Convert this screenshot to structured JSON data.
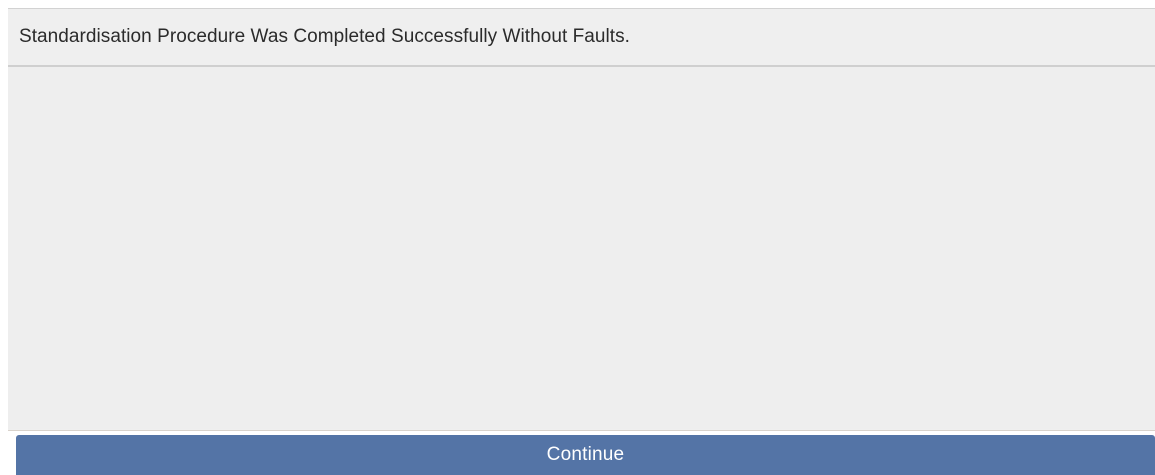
{
  "dialog": {
    "message": "Standardisation Procedure Was Completed Successfully Without Faults.",
    "continue_label": "Continue"
  },
  "colors": {
    "panel_background": "#efefef",
    "button_background": "#5474a6",
    "button_text": "#ffffff",
    "message_text": "#2b2b2b"
  }
}
